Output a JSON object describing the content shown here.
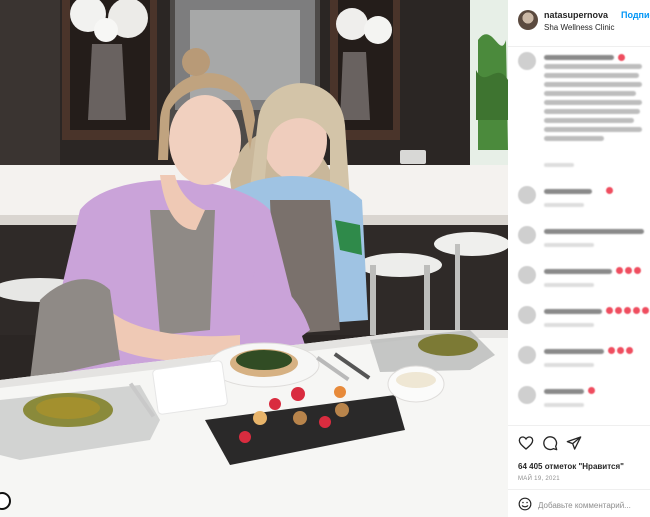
{
  "post": {
    "username": "natasupernova",
    "follow_label": "Подпис",
    "location": "Sha Wellness Clinic",
    "likes_text": "64 405 отметок \"Нравится\"",
    "date_text": "МАЙ 19, 2021",
    "comment_placeholder": "Добавьте комментарий..."
  },
  "icons": {
    "like": "heart-icon",
    "comment": "comment-icon",
    "share": "share-icon",
    "emoji": "emoji-icon"
  },
  "colors": {
    "link_blue": "#0095f6",
    "emoji_heart_red": "#ef4d5f"
  }
}
